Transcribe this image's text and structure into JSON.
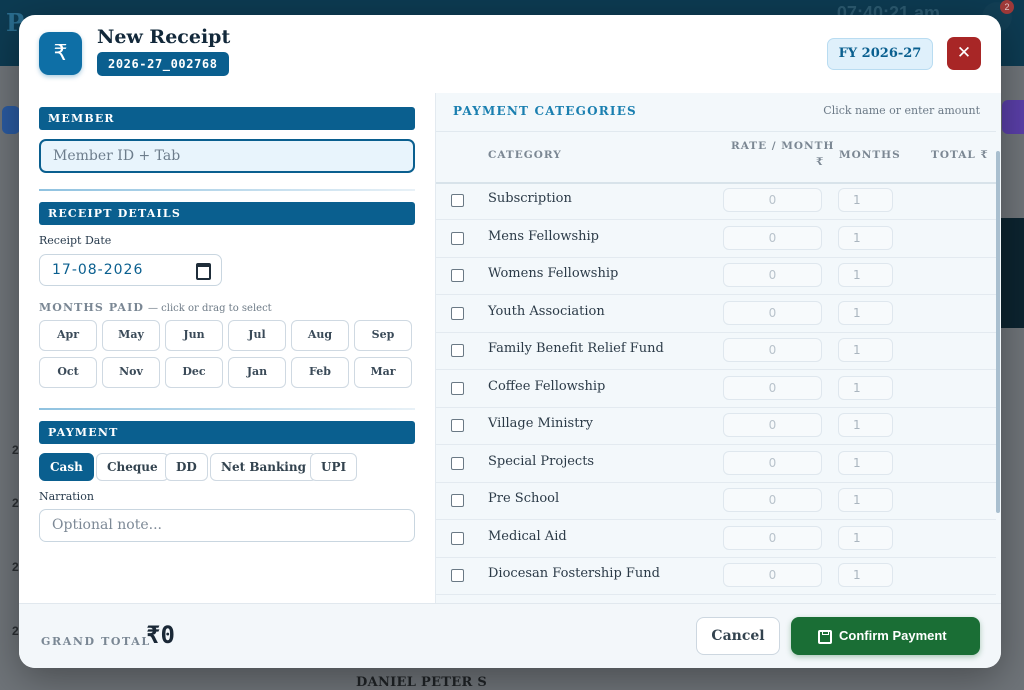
{
  "background": {
    "title": "Pa",
    "clock": "07:40:21 am",
    "notification_count": "2",
    "row_numbers": [
      "2",
      "2",
      "2",
      "2"
    ],
    "footer_name": "DANIEL PETER S"
  },
  "header": {
    "icon": "rupee-icon",
    "title": "New Receipt",
    "receipt_no": "2026-27_002768",
    "fy": "FY 2026-27",
    "close_glyph": "✕"
  },
  "member": {
    "section": "MEMBER",
    "placeholder": "Member ID + Tab"
  },
  "receipt_details": {
    "section": "RECEIPT DETAILS",
    "date_label": "Receipt Date",
    "date_value": "17-08-2026",
    "months_label": "MONTHS PAID",
    "months_hint": "— click or drag to select",
    "months": [
      "Apr",
      "May",
      "Jun",
      "Jul",
      "Aug",
      "Sep",
      "Oct",
      "Nov",
      "Dec",
      "Jan",
      "Feb",
      "Mar"
    ]
  },
  "payment": {
    "section": "PAYMENT",
    "modes": [
      "Cash",
      "Cheque",
      "DD",
      "Net Banking",
      "UPI"
    ],
    "selected_mode": "Cash",
    "narration_label": "Narration",
    "narration_placeholder": "Optional note..."
  },
  "categories": {
    "title": "PAYMENT CATEGORIES",
    "hint": "Click name or enter amount",
    "columns": {
      "category": "CATEGORY",
      "rate": "RATE / MONTH",
      "rate_unit": "₹",
      "months": "MONTHS",
      "total": "TOTAL ₹"
    },
    "rows": [
      {
        "name": "Subscription",
        "rate": "0",
        "months": "1"
      },
      {
        "name": "Mens Fellowship",
        "rate": "0",
        "months": "1"
      },
      {
        "name": "Womens Fellowship",
        "rate": "0",
        "months": "1"
      },
      {
        "name": "Youth Association",
        "rate": "0",
        "months": "1"
      },
      {
        "name": "Family Benefit Relief Fund",
        "rate": "0",
        "months": "1"
      },
      {
        "name": "Coffee Fellowship",
        "rate": "0",
        "months": "1"
      },
      {
        "name": "Village Ministry",
        "rate": "0",
        "months": "1"
      },
      {
        "name": "Special Projects",
        "rate": "0",
        "months": "1"
      },
      {
        "name": "Pre School",
        "rate": "0",
        "months": "1"
      },
      {
        "name": "Medical Aid",
        "rate": "0",
        "months": "1"
      },
      {
        "name": "Diocesan Fostership Fund",
        "rate": "0",
        "months": "1"
      }
    ]
  },
  "footer": {
    "grand_total_label": "GRAND TOTAL",
    "grand_total_value": "₹0",
    "cancel_label": "Cancel",
    "confirm_label": "Confirm Payment"
  },
  "colors": {
    "primary": "#0a5f8f",
    "confirm": "#1a6e35",
    "close": "#a82626"
  }
}
